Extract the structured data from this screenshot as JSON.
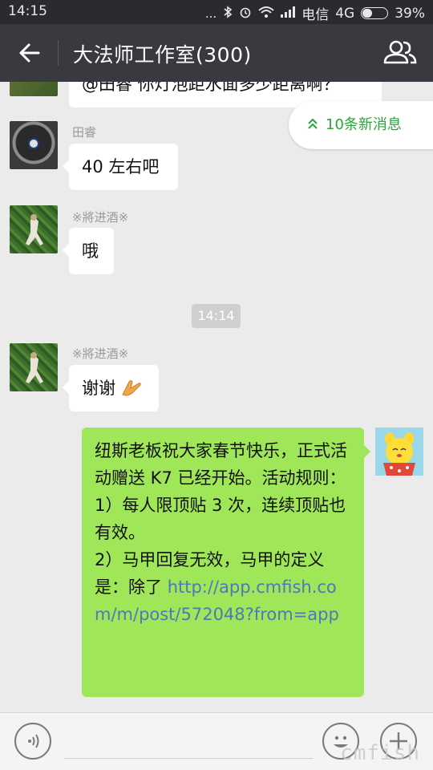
{
  "status_bar": {
    "time": "14:15",
    "dots": "...",
    "carrier": "电信",
    "network": "4G",
    "battery_pct_text": "39%",
    "battery_level": 0.39
  },
  "header": {
    "title": "大法师工作室(300)"
  },
  "new_messages": {
    "label": "10条新消息"
  },
  "messages": [
    {
      "text": "@田睿 你灯泡距水面多少距离啊？"
    },
    {
      "sender": "田睿",
      "text": "40 左右吧"
    },
    {
      "sender": "※將进酒※",
      "text": "哦"
    },
    {
      "sender": "※將进酒※",
      "text": "谢谢"
    }
  ],
  "timestamp": "14:14",
  "outgoing": {
    "lines": [
      "纽斯老板祝大家春节快乐，正式活动赠送 K7 已经开始。活动规则：",
      "1）每人限顶贴 3 次，连续顶贴也有效。",
      "2）马甲回复无效，马甲的定义是：除了 "
    ],
    "link": "http://app.cmfish.com/m/post/572048?from=app"
  },
  "watermark": "cmfish",
  "colors": {
    "accent_green": "#2aa53a",
    "outgoing_bubble": "#9fe658",
    "header_bg": "#393a3f"
  }
}
